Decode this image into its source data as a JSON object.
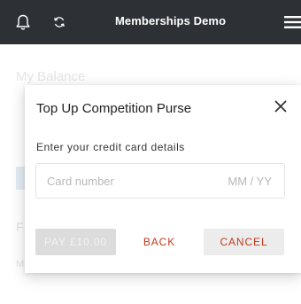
{
  "header": {
    "title": "Memberships Demo",
    "icons": {
      "notifications": "bell-icon",
      "refresh": "refresh-icon",
      "menu": "hamburger-menu-icon"
    }
  },
  "background": {
    "section_title": "My Balance",
    "partial_f": "F",
    "partial_m": "M"
  },
  "dialog": {
    "title": "Top Up Competition Purse",
    "close_icon": "close-icon",
    "subtitle": "Enter your credit card details",
    "card_number_placeholder": "Card number",
    "expiry_placeholder": "MM / YY",
    "buttons": {
      "pay": "PAY £10.00",
      "back": "BACK",
      "cancel": "CANCEL"
    }
  },
  "colors": {
    "topbar": "#2d3035",
    "accent": "#c1391b",
    "disabled_button": "#dcdcdc"
  }
}
